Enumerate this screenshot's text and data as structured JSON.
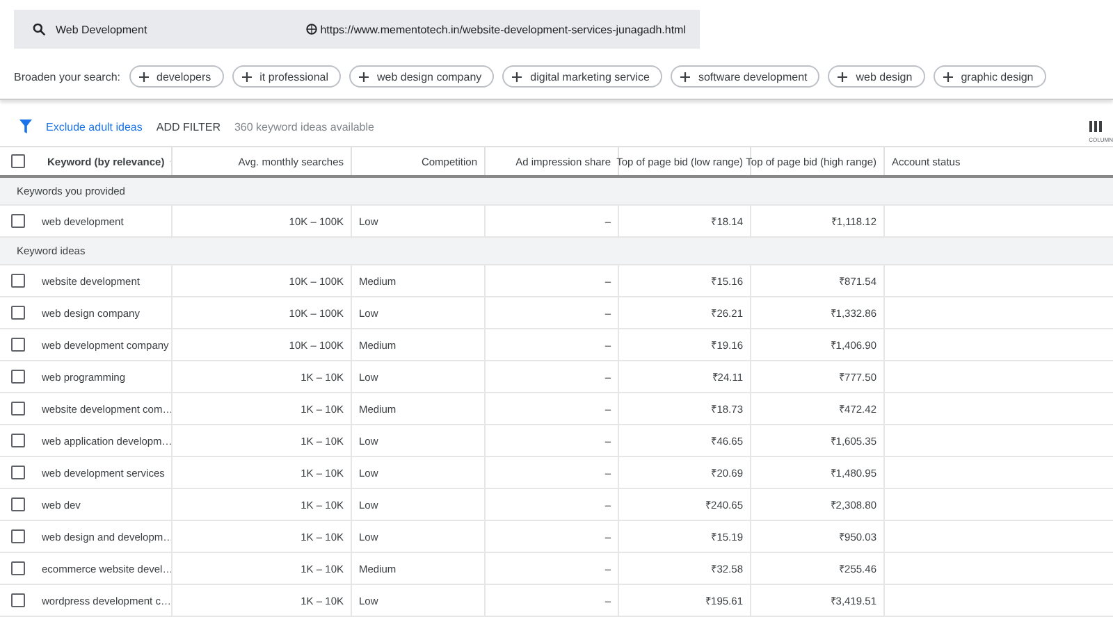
{
  "search": {
    "query": "Web Development",
    "url": "https://www.mementotech.in/website-development-services-junagadh.html"
  },
  "broaden": {
    "label": "Broaden your search:",
    "chips": [
      "developers",
      "it professional",
      "web design company",
      "digital marketing service",
      "software development",
      "web design",
      "graphic design"
    ]
  },
  "filter_bar": {
    "exclude_adult": "Exclude adult ideas",
    "add_filter": "ADD FILTER",
    "count": "360 keyword ideas available",
    "columns_label": "COLUMN"
  },
  "table": {
    "header_checked": false,
    "columns": [
      "Keyword (by relevance)",
      "Avg. monthly searches",
      "Competition",
      "Ad impression share",
      "Top of page bid (low range)",
      "Top of page bid (high range)",
      "Account status"
    ],
    "rows": [
      {
        "kind": "group",
        "label": "Keywords you provided"
      },
      {
        "kind": "keyword",
        "checked": false,
        "cells": [
          "web development",
          "10K – 100K",
          "Low",
          "–",
          "₹18.14",
          "₹1,118.12"
        ]
      },
      {
        "kind": "group",
        "label": "Keyword ideas"
      },
      {
        "kind": "keyword",
        "checked": false,
        "cells": [
          "website development",
          "10K – 100K",
          "Medium",
          "–",
          "₹15.16",
          "₹871.54"
        ]
      },
      {
        "kind": "keyword",
        "checked": false,
        "cells": [
          "web design company",
          "10K – 100K",
          "Low",
          "–",
          "₹26.21",
          "₹1,332.86"
        ]
      },
      {
        "kind": "keyword",
        "checked": false,
        "cells": [
          "web development company",
          "10K – 100K",
          "Medium",
          "–",
          "₹19.16",
          "₹1,406.90"
        ]
      },
      {
        "kind": "keyword",
        "checked": false,
        "cells": [
          "web programming",
          "1K – 10K",
          "Low",
          "–",
          "₹24.11",
          "₹777.50"
        ]
      },
      {
        "kind": "keyword",
        "checked": false,
        "cells": [
          "website development com…",
          "1K – 10K",
          "Medium",
          "–",
          "₹18.73",
          "₹472.42"
        ]
      },
      {
        "kind": "keyword",
        "checked": false,
        "cells": [
          "web application developm…",
          "1K – 10K",
          "Low",
          "–",
          "₹46.65",
          "₹1,605.35"
        ]
      },
      {
        "kind": "keyword",
        "checked": false,
        "cells": [
          "web development services",
          "1K – 10K",
          "Low",
          "–",
          "₹20.69",
          "₹1,480.95"
        ]
      },
      {
        "kind": "keyword",
        "checked": false,
        "cells": [
          "web dev",
          "1K – 10K",
          "Low",
          "–",
          "₹240.65",
          "₹2,308.80"
        ]
      },
      {
        "kind": "keyword",
        "checked": false,
        "cells": [
          "web design and developm…",
          "1K – 10K",
          "Low",
          "–",
          "₹15.19",
          "₹950.03"
        ]
      },
      {
        "kind": "keyword",
        "checked": false,
        "cells": [
          "ecommerce website devel…",
          "1K – 10K",
          "Medium",
          "–",
          "₹32.58",
          "₹255.46"
        ]
      },
      {
        "kind": "keyword",
        "checked": false,
        "cells": [
          "wordpress development c…",
          "1K – 10K",
          "Low",
          "–",
          "₹195.61",
          "₹3,419.51"
        ]
      }
    ]
  }
}
